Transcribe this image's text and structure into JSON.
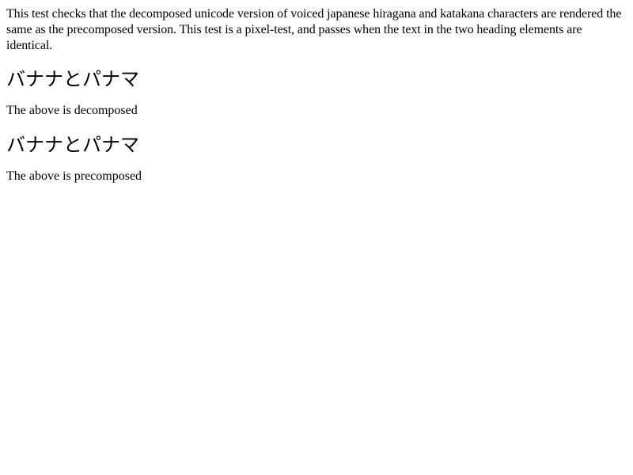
{
  "intro_text": "This test checks that the decomposed unicode version of voiced japanese hiragana and katakana characters are rendered the same as the precomposed version. This test is a pixel-test, and passes when the text in the two heading elements are identical.",
  "decomposed": {
    "heading": "バナナとパナマ",
    "caption": "The above is decomposed"
  },
  "precomposed": {
    "heading": "バナナとパナマ",
    "caption": "The above is precomposed"
  }
}
